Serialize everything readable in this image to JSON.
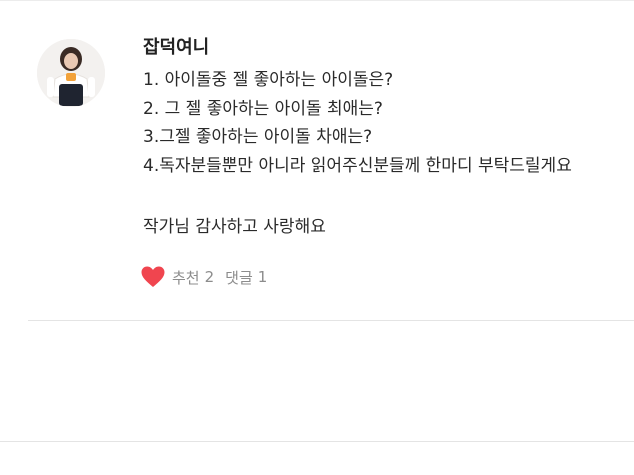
{
  "comment": {
    "username": "잡덕여니",
    "avatar_icon": "profile-photo",
    "body_lines": [
      "1. 아이돌중 젤 좋아하는 아이돌은?",
      "2. 그 젤 좋아하는 아이돌 최애는?",
      "3.그젤 좋아하는 아이돌 차애는?",
      "4.독자분들뿐만 아니라 읽어주신분들께 한마디 부탁드릴게요"
    ],
    "closing_line": "작가님 감사하고 사랑해요",
    "actions": {
      "like_icon": "heart-icon",
      "like_color": "#f0454f",
      "like_label": "추천",
      "like_count": "2",
      "reply_label": "댓글",
      "reply_count": "1"
    }
  }
}
